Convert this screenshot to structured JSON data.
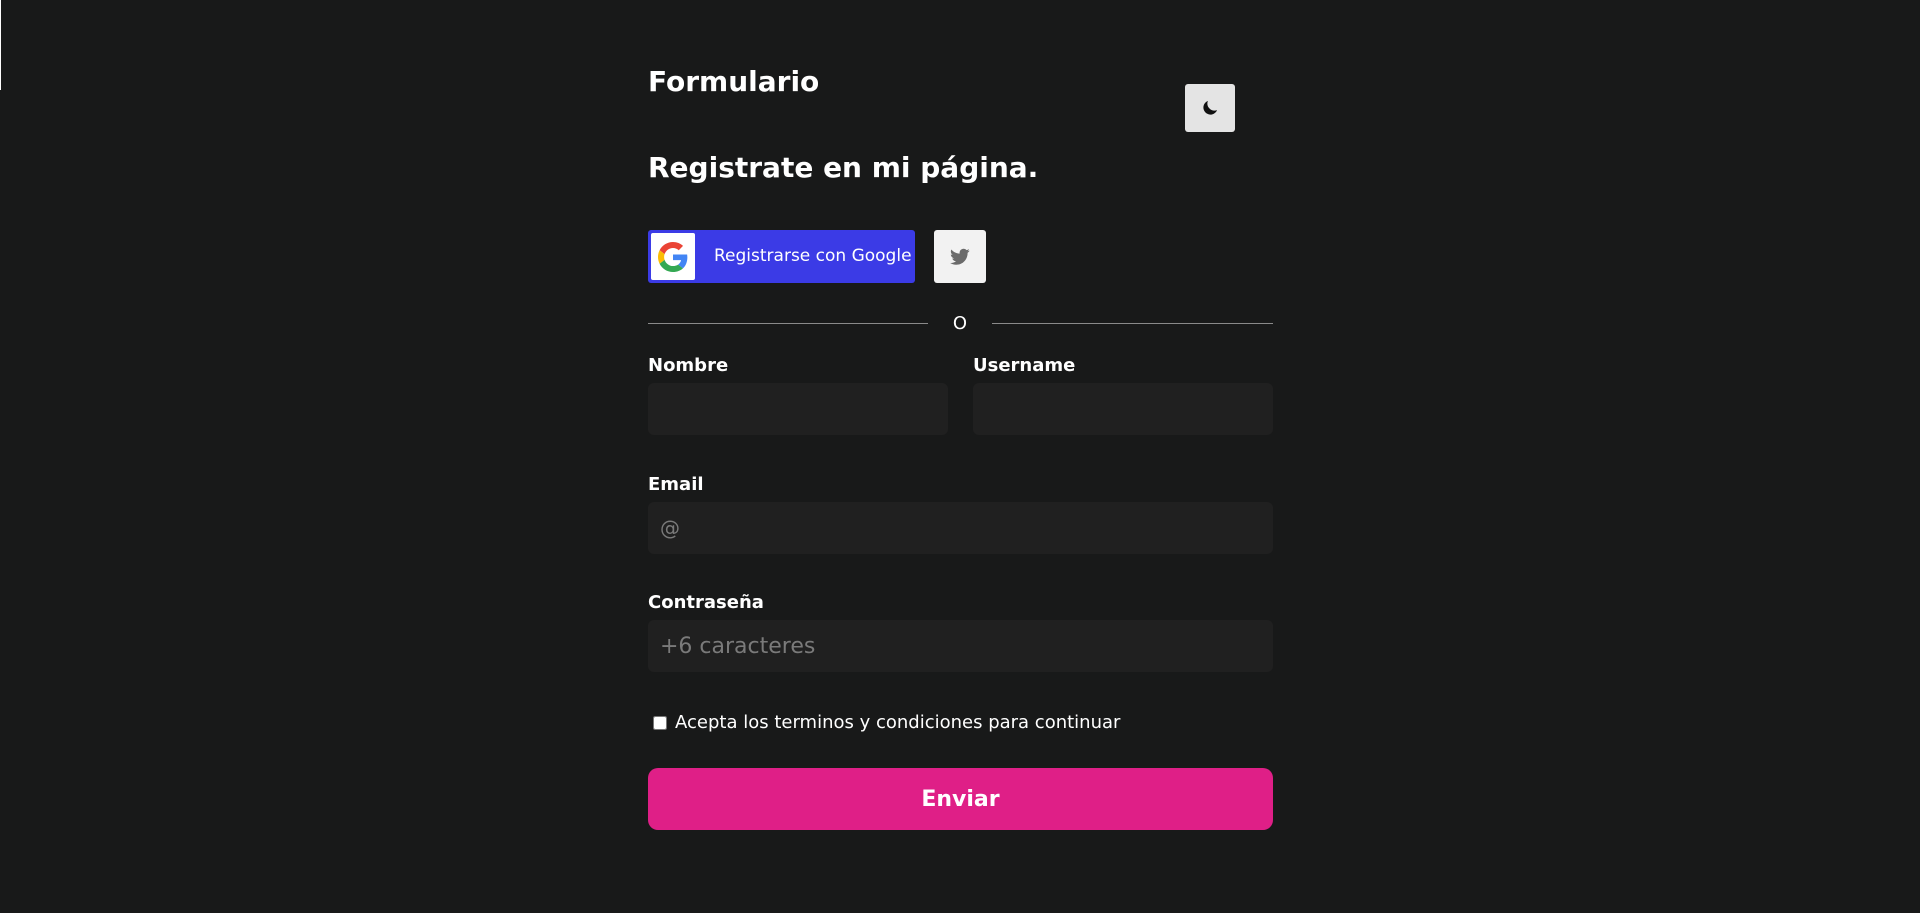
{
  "header": {
    "title": "Formulario",
    "subtitle": "Registrate en mi página."
  },
  "theme_toggle": {
    "icon": "moon-icon"
  },
  "social": {
    "google_label": "Registrarse con Google",
    "google_icon": "google-logo-icon",
    "twitter_icon": "twitter-bird-icon"
  },
  "divider": {
    "text": "O"
  },
  "fields": {
    "nombre": {
      "label": "Nombre",
      "value": "",
      "placeholder": ""
    },
    "username": {
      "label": "Username",
      "value": "",
      "placeholder": ""
    },
    "email": {
      "label": "Email",
      "value": "",
      "placeholder": "@"
    },
    "password": {
      "label": "Contraseña",
      "value": "",
      "placeholder": "+6 caracteres"
    }
  },
  "terms": {
    "label": "Acepta los terminos y condiciones para continuar",
    "checked": false
  },
  "submit": {
    "label": "Enviar"
  },
  "colors": {
    "background": "#181919",
    "google_button": "#3b3be6",
    "submit_button": "#df1f87",
    "input_background": "#202020",
    "toggle_background": "#e4e4e4"
  }
}
